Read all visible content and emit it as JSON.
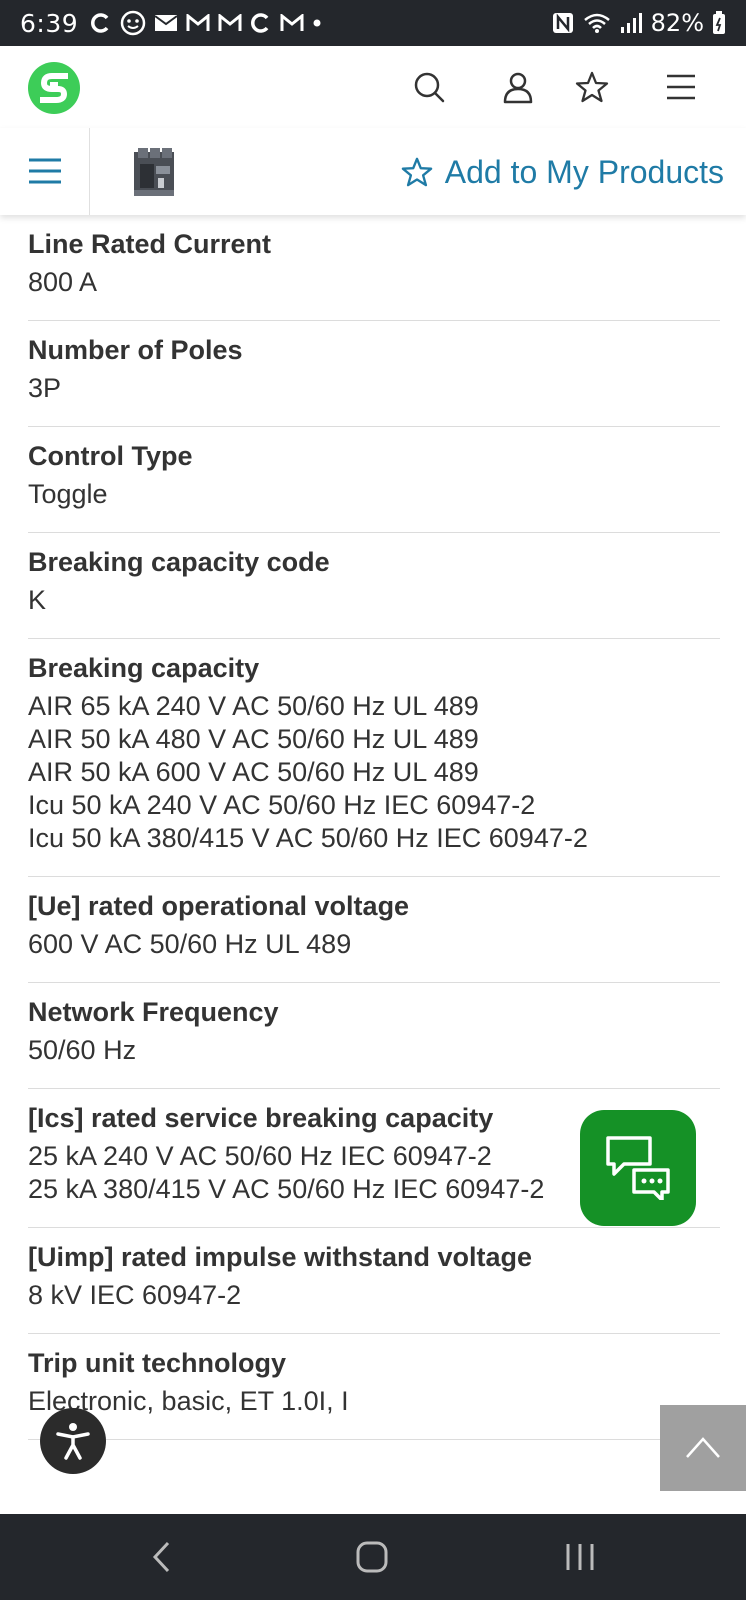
{
  "status_bar": {
    "time": "6:39",
    "battery": "82%",
    "notification_icons": [
      "c-icon",
      "face-icon",
      "mail-icon",
      "gmail-icon",
      "gmail-icon",
      "c-icon",
      "gmail-icon",
      "dot-icon"
    ],
    "right_icons": [
      "nfc-icon",
      "wifi-icon",
      "signal-icon",
      "battery-icon"
    ]
  },
  "header": {
    "logo": "schneider-electric-logo",
    "icons": [
      "search-icon",
      "user-icon",
      "star-icon",
      "menu-icon"
    ]
  },
  "product_bar": {
    "add_label": "Add to My Products"
  },
  "specs": [
    {
      "label": "Line Rated Current",
      "values": [
        "800 A"
      ]
    },
    {
      "label": "Number of Poles",
      "values": [
        "3P"
      ]
    },
    {
      "label": "Control Type",
      "values": [
        "Toggle"
      ]
    },
    {
      "label": "Breaking capacity code",
      "values": [
        "K"
      ]
    },
    {
      "label": "Breaking capacity",
      "values": [
        "AIR 65 kA 240 V AC 50/60 Hz UL 489",
        "AIR 50 kA 480 V AC 50/60 Hz UL 489",
        "AIR 50 kA 600 V AC 50/60 Hz UL 489",
        "Icu 50 kA 240 V AC 50/60 Hz IEC 60947-2",
        "Icu 50 kA 380/415 V AC 50/60 Hz IEC 60947-2"
      ]
    },
    {
      "label": "[Ue] rated operational voltage",
      "values": [
        "600 V AC 50/60 Hz UL 489"
      ]
    },
    {
      "label": "Network Frequency",
      "values": [
        "50/60 Hz"
      ]
    },
    {
      "label": "[Ics] rated service breaking capacity",
      "values": [
        "25 kA 240 V AC 50/60 Hz IEC 60947-2",
        "25 kA 380/415 V AC 50/60 Hz IEC 60947-2"
      ]
    },
    {
      "label": "[Uimp] rated impulse withstand voltage",
      "values": [
        "8 kV IEC 60947-2"
      ]
    },
    {
      "label": "Trip unit technology",
      "values": [
        "Electronic, basic, ET 1.0I, I"
      ]
    }
  ],
  "colors": {
    "brand_green": "#3dcd58",
    "link_blue": "#1f7ba6",
    "chat_green": "#159126",
    "system_bar": "#24272c"
  },
  "floating": [
    "chat-icon",
    "accessibility-icon",
    "chevron-up-icon"
  ],
  "nav_bar": [
    "back-icon",
    "home-icon",
    "recents-icon"
  ]
}
